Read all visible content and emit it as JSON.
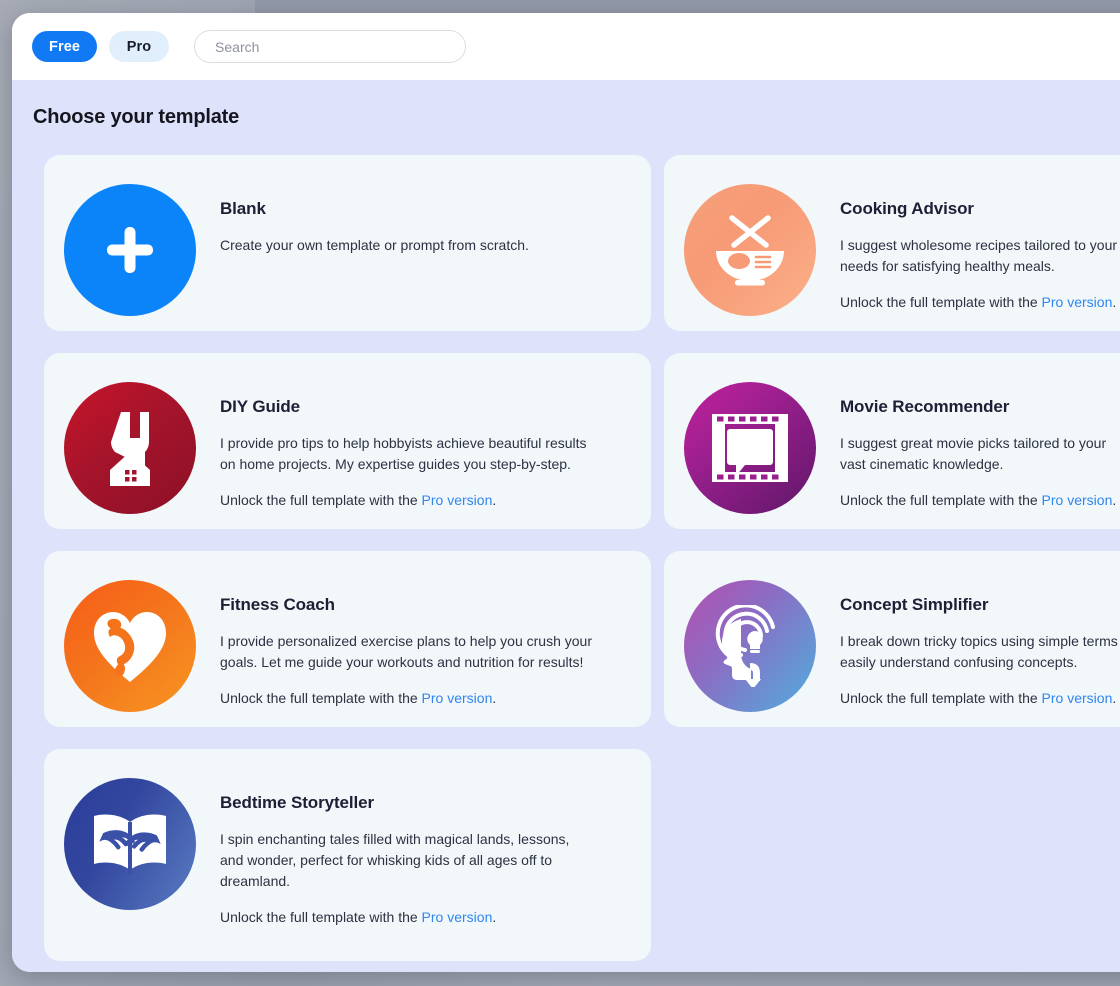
{
  "toolbar": {
    "tabs": [
      {
        "label": "Free",
        "state": "active"
      },
      {
        "label": "Pro",
        "state": "inactive"
      }
    ],
    "search": {
      "placeholder": "Search",
      "value": ""
    }
  },
  "header": {
    "title": "Choose your template"
  },
  "colors": {
    "accent_blue": "#1279f4",
    "pill_inactive_bg": "#e1effc",
    "page_bg": "#dee3fb",
    "card_bg": "#f2f7fa",
    "link_blue": "#2f86f0",
    "desktop_bg": "#a9aeb9"
  },
  "unlock_text": {
    "prefix": "Unlock the full template with the ",
    "link": "Pro version",
    "suffix": "."
  },
  "cards": [
    {
      "id": "blank",
      "icon": "plus-icon",
      "title": "Blank",
      "description": "Create your own template or prompt from scratch.",
      "has_unlock": false
    },
    {
      "id": "cooking-advisor",
      "icon": "bowl-utensils-icon",
      "title": "Cooking Advisor",
      "description": "I suggest wholesome recipes tailored to your\nneeds for satisfying healthy meals.",
      "has_unlock": true
    },
    {
      "id": "diy-guide",
      "icon": "wrench-house-icon",
      "title": "DIY Guide",
      "description": "I provide pro tips to help hobbyists achieve beautiful results\non home projects. My expertise guides you step-by-step.",
      "has_unlock": true
    },
    {
      "id": "movie-recommender",
      "icon": "film-strip-icon",
      "title": "Movie Recommender",
      "description": "I suggest great movie picks tailored to your\nvast cinematic knowledge.",
      "has_unlock": true
    },
    {
      "id": "fitness-coach",
      "icon": "heart-bicep-icon",
      "title": "Fitness Coach",
      "description": "I provide personalized exercise plans to help you crush your\ngoals. Let me guide your workouts and nutrition for results!",
      "has_unlock": true
    },
    {
      "id": "concept-simplifier",
      "icon": "head-lightbulb-icon",
      "title": "Concept Simplifier",
      "description": "I break down tricky topics using simple terms\neasily understand confusing concepts.",
      "has_unlock": true
    },
    {
      "id": "bedtime-storyteller",
      "icon": "open-book-hands-icon",
      "title": "Bedtime Storyteller",
      "description": "I spin enchanting tales filled with magical lands, lessons,\nand wonder, perfect for whisking kids of all ages off to\ndreamland.",
      "has_unlock": true
    }
  ]
}
